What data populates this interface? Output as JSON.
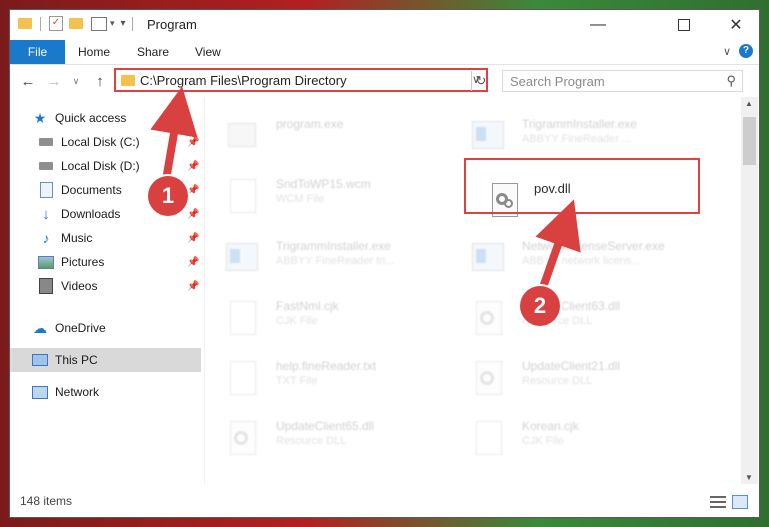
{
  "window": {
    "title": "Program"
  },
  "ribbon": {
    "tabs": [
      "File",
      "Home",
      "Share",
      "View"
    ],
    "help": "?"
  },
  "address": {
    "path": "C:\\Program Files\\Program Directory"
  },
  "search": {
    "placeholder": "Search Program"
  },
  "sidebar": {
    "quick_access": "Quick access",
    "items": [
      {
        "label": "Local Disk (C:)",
        "icon": "drive-icon"
      },
      {
        "label": "Local Disk (D:)",
        "icon": "drive-icon"
      },
      {
        "label": "Documents",
        "icon": "documents-icon"
      },
      {
        "label": "Downloads",
        "icon": "downloads-icon"
      },
      {
        "label": "Music",
        "icon": "music-icon"
      },
      {
        "label": "Pictures",
        "icon": "pictures-icon"
      },
      {
        "label": "Videos",
        "icon": "videos-icon"
      }
    ],
    "onedrive": "OneDrive",
    "thispc": "This PC",
    "network": "Network"
  },
  "files": [
    {
      "name": "program.exe",
      "type": ""
    },
    {
      "name": "TrigrammInstaller.exe",
      "type": "ABBYY FineReader ..."
    },
    {
      "name": "SndToWP15.wcm",
      "type": "WCM File"
    },
    {
      "name": "pov.dll",
      "type": ""
    },
    {
      "name": "TrigrammInstaller.exe",
      "type": "ABBYY FineReader tri..."
    },
    {
      "name": "NetworkLicenseServer.exe",
      "type": "ABBYY network licens..."
    },
    {
      "name": "FastNml.cjk",
      "type": "CJK File"
    },
    {
      "name": "UpdateClient63.dll",
      "type": "Resource DLL"
    },
    {
      "name": "help.fineReader.txt",
      "type": "TXT File"
    },
    {
      "name": "UpdateClient21.dll",
      "type": "Resource DLL"
    },
    {
      "name": "UpdateClient65.dll",
      "type": "Resource DLL"
    },
    {
      "name": "Korean.cjk",
      "type": "CJK File"
    }
  ],
  "status": {
    "count": "148 items"
  },
  "annotations": {
    "step1": "1",
    "step2": "2"
  },
  "colors": {
    "accent": "#1979ca",
    "highlight": "#e04040",
    "badge": "#d94141"
  }
}
